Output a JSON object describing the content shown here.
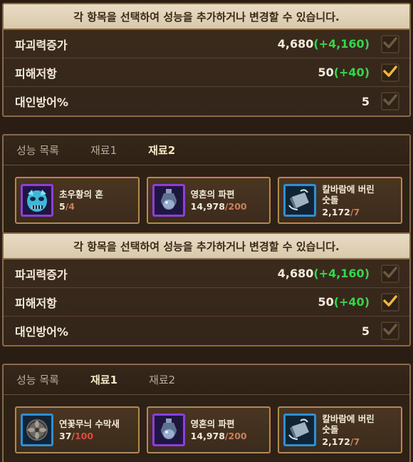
{
  "sections": [
    {
      "banner": "각 항목을 선택하여 성능을 추가하거나 변경할 수 있습니다.",
      "stats": [
        {
          "name": "파괴력증가",
          "value": "4,680",
          "bonus": "(+4,160)",
          "checked": false
        },
        {
          "name": "피해저항",
          "value": "50",
          "bonus": "(+40)",
          "checked": true
        },
        {
          "name": "대인방어%",
          "value": "5",
          "bonus": "",
          "checked": false
        }
      ],
      "tabs": [
        "성능 목록",
        "재료1",
        "재료2"
      ],
      "active_tab": 2,
      "materials": [
        {
          "name": "초우황의 혼",
          "have": "5",
          "sep": "/",
          "need": "4",
          "frame": "purple",
          "icon": "demon-mask-icon",
          "short": false
        },
        {
          "name": "영혼의 파편",
          "have": "14,978",
          "sep": "/",
          "need": "200",
          "frame": "purple",
          "icon": "soul-vial-icon",
          "short": false
        },
        {
          "name": "칼바람에 버린\n숫돌",
          "have": "2,172",
          "sep": "/",
          "need": "7",
          "frame": "blue",
          "icon": "whetstone-icon",
          "short": false
        }
      ]
    },
    {
      "banner": "각 항목을 선택하여 성능을 추가하거나 변경할 수 있습니다.",
      "stats": [
        {
          "name": "파괴력증가",
          "value": "4,680",
          "bonus": "(+4,160)",
          "checked": false
        },
        {
          "name": "피해저항",
          "value": "50",
          "bonus": "(+40)",
          "checked": true
        },
        {
          "name": "대인방어%",
          "value": "5",
          "bonus": "",
          "checked": false
        }
      ],
      "tabs": [
        "성능 목록",
        "재료1",
        "재료2"
      ],
      "active_tab": 1,
      "materials": [
        {
          "name": "연꽃무늬 수막새",
          "have": "37",
          "sep": "/",
          "need": "100",
          "frame": "blue",
          "icon": "lotus-tile-icon",
          "short": true
        },
        {
          "name": "영혼의 파편",
          "have": "14,978",
          "sep": "/",
          "need": "200",
          "frame": "purple",
          "icon": "soul-vial-icon",
          "short": false
        },
        {
          "name": "칼바람에 버린\n숫돌",
          "have": "2,172",
          "sep": "/",
          "need": "7",
          "frame": "blue",
          "icon": "whetstone-icon",
          "short": false
        }
      ]
    }
  ],
  "colors": {
    "bonus": "#34d64a",
    "check_active": "#f2b53b",
    "check_inactive": "#6b5a44",
    "need_short": "#e04a3c"
  }
}
